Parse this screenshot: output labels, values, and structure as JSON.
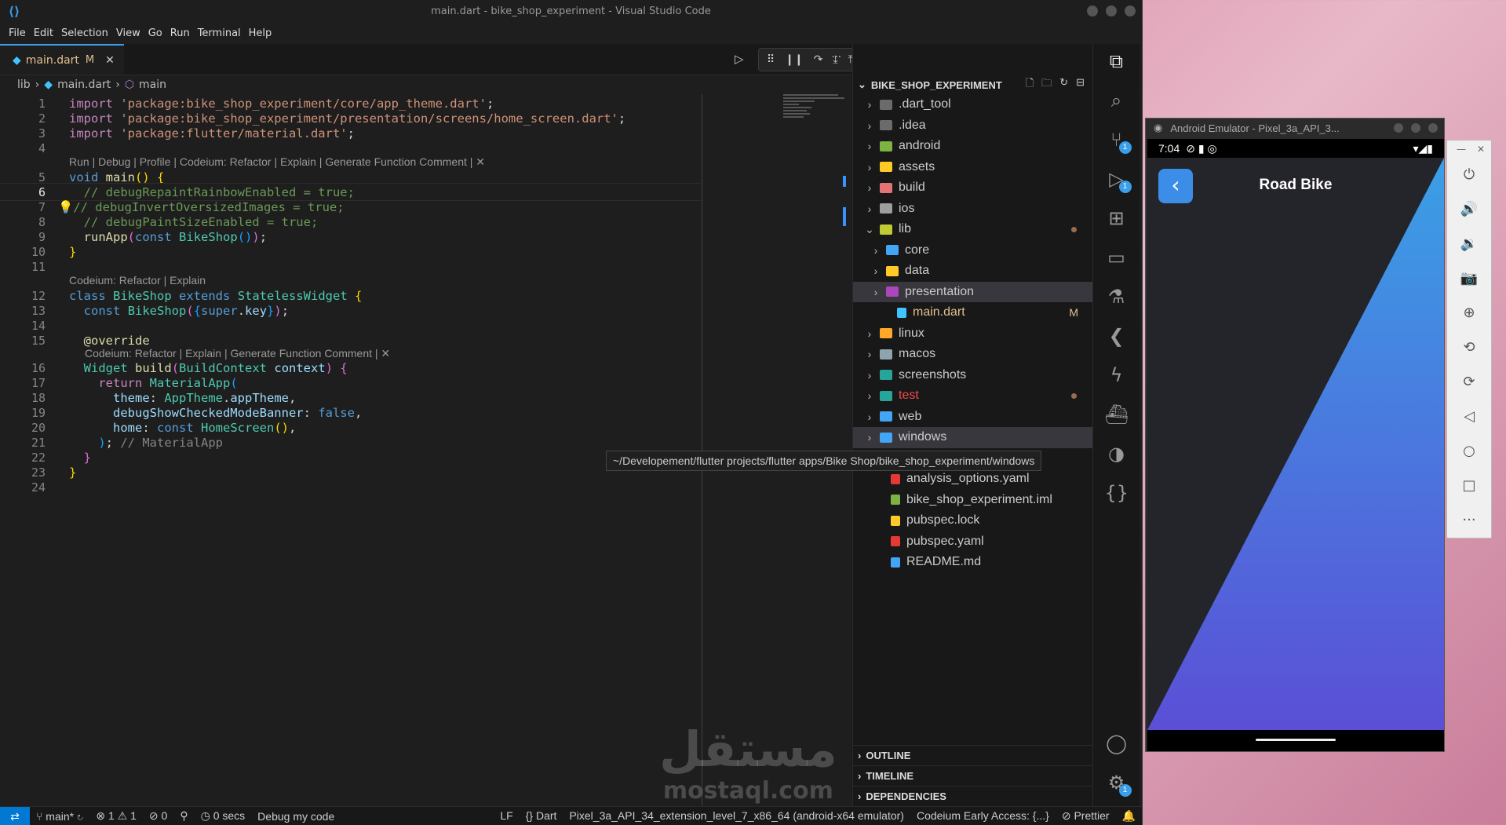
{
  "window": {
    "title": "main.dart - bike_shop_experiment - Visual Studio Code"
  },
  "menu": [
    "File",
    "Edit",
    "Selection",
    "View",
    "Go",
    "Run",
    "Terminal",
    "Help"
  ],
  "tab": {
    "name": "main.dart",
    "status": "M"
  },
  "breadcrumb": {
    "folder": "lib",
    "file": "main.dart",
    "symbol": "main"
  },
  "code": {
    "line_numbers": [
      "1",
      "2",
      "3",
      "4",
      "5",
      "6",
      "7",
      "8",
      "9",
      "10",
      "11",
      "12",
      "13",
      "14",
      "15",
      "16",
      "17",
      "18",
      "19",
      "20",
      "21",
      "22",
      "23",
      "24"
    ],
    "lens1": "Run | Debug | Profile | Codeium: Refactor | Explain | Generate Function Comment | ✕",
    "lens2": "Codeium: Refactor | Explain",
    "lens3": "Codeium: Refactor | Explain | Generate Function Comment | ✕",
    "imports": [
      "'package:bike_shop_experiment/core/app_theme.dart'",
      "'package:bike_shop_experiment/presentation/screens/home_screen.dart'",
      "'package:flutter/material.dart'"
    ],
    "comments": [
      "// debugRepaintRainbowEnabled = true;",
      "// debugInvertOversizedImages = true;",
      "// debugPaintSizeEnabled = true;",
      "// MaterialApp"
    ]
  },
  "explorer": {
    "title": "BIKE_SHOP_EXPERIMENT",
    "items": [
      {
        "label": ".dart_tool",
        "color": "#6b6b6b"
      },
      {
        "label": ".idea",
        "color": "#6b6b6b"
      },
      {
        "label": "android",
        "color": "#7cb342"
      },
      {
        "label": "assets",
        "color": "#ffca28"
      },
      {
        "label": "build",
        "color": "#e57373"
      },
      {
        "label": "ios",
        "color": "#9e9e9e"
      },
      {
        "label": "lib",
        "color": "#c0ca33"
      },
      {
        "label": "core",
        "color": "#42a5f5"
      },
      {
        "label": "data",
        "color": "#ffca28"
      },
      {
        "label": "presentation",
        "color": "#ab47bc"
      },
      {
        "label": "main.dart",
        "color": "#40c4ff",
        "mod": "M"
      },
      {
        "label": "linux",
        "color": "#ffa726"
      },
      {
        "label": "macos",
        "color": "#90a4ae"
      },
      {
        "label": "screenshots",
        "color": "#26a69a"
      },
      {
        "label": "test",
        "color": "#26a69a"
      },
      {
        "label": "web",
        "color": "#42a5f5"
      },
      {
        "label": "windows",
        "color": "#42a5f5"
      },
      {
        "label": ".metadata",
        "color": "#9e9e9e"
      },
      {
        "label": "analysis_options.yaml",
        "color": "#e53935"
      },
      {
        "label": "bike_shop_experiment.iml",
        "color": "#7cb342"
      },
      {
        "label": "pubspec.lock",
        "color": "#ffca28"
      },
      {
        "label": "pubspec.yaml",
        "color": "#e53935"
      },
      {
        "label": "README.md",
        "color": "#42a5f5"
      }
    ],
    "tooltip": "~/Developement/flutter projects/flutter apps/Bike Shop/bike_shop_experiment/windows",
    "panels": [
      "OUTLINE",
      "TIMELINE",
      "DEPENDENCIES"
    ]
  },
  "activity": {
    "scm_badge": "1",
    "debug_badge": "1",
    "settings_badge": "1"
  },
  "statusbar": {
    "branch": "main*",
    "problems": "⊗ 1 ⚠ 1",
    "ports": "⊘ 0",
    "time": "0 secs",
    "debug": "Debug my code",
    "eol": "LF",
    "lang": "Dart",
    "device": "Pixel_3a_API_34_extension_level_7_x86_64 (android-x64 emulator)",
    "codeium": "Codeium Early Access: {...}",
    "prettier": "Prettier"
  },
  "watermark": {
    "arabic": "مستقل",
    "latin": "mostaql.com"
  },
  "emulator": {
    "title": "Android Emulator - Pixel_3a_API_3...",
    "time": "7:04",
    "app_title": "Road Bike",
    "colors": {
      "app_bg": "#24242b",
      "gradient_top": "#3aa0e6",
      "gradient_bottom": "#5b4fd6",
      "back_button": "#3b8de8"
    }
  },
  "colors": {
    "accent": "#0078d4",
    "editor_bg": "#1e1e1e",
    "sidebar_bg": "#181818"
  }
}
